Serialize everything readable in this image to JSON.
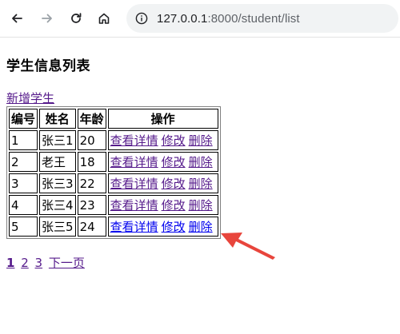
{
  "browser": {
    "url_host": "127.0.0.1",
    "url_rest": ":8000/student/list",
    "back_icon": "arrow-left-icon",
    "forward_icon": "arrow-right-icon",
    "reload_icon": "reload-icon",
    "home_icon": "home-icon",
    "info_icon": "info-icon"
  },
  "page": {
    "title": "学生信息列表",
    "add_link": "新增学生"
  },
  "table": {
    "headers": [
      "编号",
      "姓名",
      "年龄",
      "操作"
    ],
    "rows": [
      {
        "id": "1",
        "name": "张三1",
        "age": "20",
        "detail": "查看详情",
        "edit": "修改",
        "delete": "删除"
      },
      {
        "id": "2",
        "name": "老王",
        "age": "18",
        "detail": "查看详情",
        "edit": "修改",
        "delete": "删除"
      },
      {
        "id": "3",
        "name": "张三3",
        "age": "22",
        "detail": "查看详情",
        "edit": "修改",
        "delete": "删除"
      },
      {
        "id": "4",
        "name": "张三4",
        "age": "23",
        "detail": "查看详情",
        "edit": "修改",
        "delete": "删除"
      },
      {
        "id": "5",
        "name": "张三5",
        "age": "24",
        "detail": "查看详情",
        "edit": "修改",
        "delete": "删除"
      }
    ]
  },
  "pagination": {
    "pages": [
      "1",
      "2",
      "3"
    ],
    "current": "1",
    "next": "下一页"
  },
  "colors": {
    "annotation_arrow": "#e8453c",
    "visited_link": "#551a8b",
    "link": "#0000ee"
  }
}
